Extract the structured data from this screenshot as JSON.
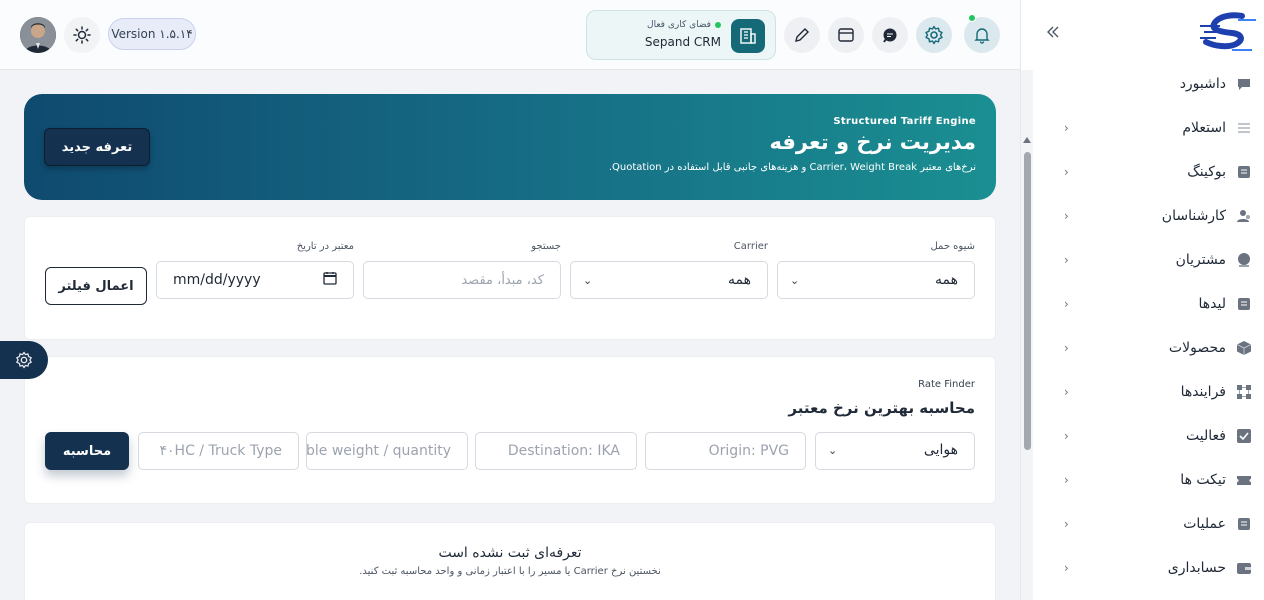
{
  "topbar": {
    "version_label": "Version ۱.۵.۱۴",
    "workspace": {
      "status": "فضای کاری فعال",
      "name": "Sepand CRM"
    }
  },
  "hero": {
    "eyebrow": "Structured Tariff Engine",
    "title": "مدیریت نرخ و تعرفه",
    "subtitle": "نرخ‌های معتبر Carrier، Weight Break و هزینه‌های جانبی قابل استفاده در Quotation.",
    "new_button": "تعرفه جدید"
  },
  "filters": {
    "mode": {
      "label": "شیوه حمل",
      "value": "همه"
    },
    "carrier": {
      "label": "Carrier",
      "value": "همه"
    },
    "search": {
      "label": "جستجو",
      "placeholder": "کد، مبدأ، مقصد"
    },
    "date": {
      "label": "معتبر در تاریخ",
      "value": "mm/dd/yyyy"
    },
    "apply_button": "اعمال فیلتر"
  },
  "rate_finder": {
    "eyebrow": "Rate Finder",
    "title": "محاسبه بهترین نرخ معتبر",
    "mode_value": "هوایی",
    "origin_placeholder": "Origin: PVG",
    "destination_placeholder": "Destination: IKA",
    "weight_placeholder": "Chargeable weight / quantity",
    "equipment_placeholder": "۴۰HC / Truck Type",
    "calc_button": "محاسبه"
  },
  "empty_state": {
    "title": "تعرفه‌ای ثبت نشده است",
    "subtitle": "نخستین نرخ Carrier یا مسیر را با اعتبار زمانی و واحد محاسبه ثبت کنید."
  },
  "sidebar": {
    "items": [
      {
        "label": "داشبورد",
        "icon": "chat-bubble-icon"
      },
      {
        "label": "استعلام",
        "icon": "menu-lines-icon"
      },
      {
        "label": "بوکینگ",
        "icon": "document-icon"
      },
      {
        "label": "کارشناسان",
        "icon": "users-icon"
      },
      {
        "label": "مشتریان",
        "icon": "user-icon"
      },
      {
        "label": "لیدها",
        "icon": "document-icon"
      },
      {
        "label": "محصولات",
        "icon": "box-icon"
      },
      {
        "label": "فرایندها",
        "icon": "process-icon"
      },
      {
        "label": "فعالیت",
        "icon": "check-square-icon"
      },
      {
        "label": "تیکت ها",
        "icon": "ticket-icon"
      },
      {
        "label": "عملیات",
        "icon": "document-icon"
      },
      {
        "label": "حسابداری",
        "icon": "wallet-icon"
      }
    ]
  },
  "colors": {
    "primary_dark": "#143150",
    "teal": "#166a78",
    "hero_start": "#0f4a6f",
    "hero_end": "#1a8f92",
    "status_green": "#22c55e"
  }
}
